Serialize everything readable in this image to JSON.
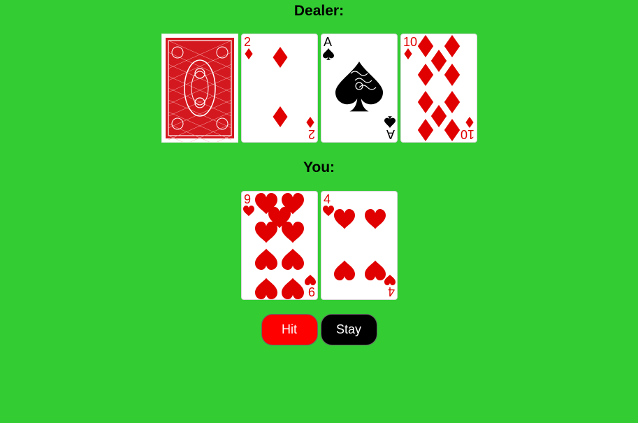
{
  "dealer": {
    "title": "Dealer:",
    "cards": [
      {
        "face_down": true
      },
      {
        "rank": "2",
        "suit": "diamonds"
      },
      {
        "rank": "A",
        "suit": "spades"
      },
      {
        "rank": "10",
        "suit": "diamonds"
      }
    ]
  },
  "player": {
    "title": "You:",
    "cards": [
      {
        "rank": "9",
        "suit": "hearts"
      },
      {
        "rank": "4",
        "suit": "hearts"
      }
    ]
  },
  "controls": {
    "hit_label": "Hit",
    "stay_label": "Stay",
    "hit_color": "#ff0000",
    "stay_color": "#000000"
  },
  "colors": {
    "table": "#33cc33",
    "red_suit": "#e00000",
    "black_suit": "#000000",
    "card_back": "#d4181f"
  }
}
